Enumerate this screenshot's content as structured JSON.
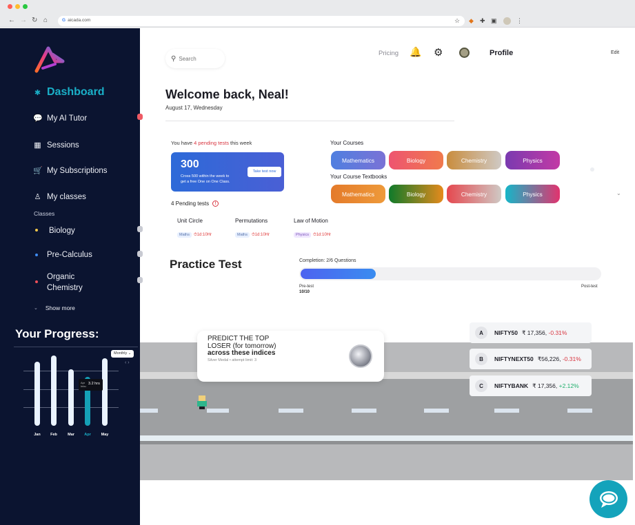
{
  "browser": {
    "url": "aicada.com"
  },
  "sidebar": {
    "dashboard": "Dashboard",
    "ai_tutor": "My AI Tutor",
    "sessions": "Sessions",
    "subscriptions": "My Subscriptions",
    "my_classes": "My classes",
    "classes_label": "Classes",
    "classes": [
      {
        "label": "Biology",
        "color": "#f3c84b"
      },
      {
        "label": "Pre-Calculus",
        "color": "#3f8cf3"
      },
      {
        "label_line1": "Organic",
        "label_line2": "Chemistry",
        "color": "#ee4f58"
      }
    ],
    "show_more": "Show more",
    "progress_title": "Your Progress:",
    "period": "Monthly",
    "chart_data": {
      "type": "bar",
      "categories": [
        "Jan",
        "Feb",
        "Mar",
        "Apr",
        "May"
      ],
      "values": [
        4.2,
        4.6,
        3.7,
        3.2,
        4.4
      ],
      "highlight": "Apr",
      "tooltip_value": "3.2 hrs",
      "tooltip_label_1": "Apr",
      "tooltip_label_2": "Inbu",
      "grid": true
    }
  },
  "header": {
    "search_placeholder": "Search",
    "pricing": "Pricing",
    "profile": "Profile",
    "edit": "Edit"
  },
  "welcome": {
    "title": "Welcome back, Neal!",
    "date": "August 17, Wednesday"
  },
  "pending": {
    "prefix": "You have ",
    "highlight": "4 pending tests",
    "suffix": " this week",
    "score": "300",
    "score_desc_1": "Cross 500 within the week to",
    "score_desc_2": "get a free One on One Class.",
    "cta": "Take test now",
    "count_label": "4 Pending tests",
    "tests": [
      {
        "title": "Unit Circle",
        "tag": "Maths",
        "time": "1d:10Hr"
      },
      {
        "title": "Permutations",
        "tag": "Maths",
        "time": "1d:10Hr"
      },
      {
        "title": "Law of Motion",
        "tag": "Physics",
        "time": "1d:10Hr"
      }
    ]
  },
  "courses": {
    "label": "Your Courses",
    "items": [
      "Mathematics",
      "Biology",
      "Chemistry",
      "Physics"
    ],
    "textbook_label": "Your Course Textbooks",
    "textbooks": [
      "Mathematics",
      "Biology",
      "Chemistry",
      "Physics"
    ]
  },
  "practice": {
    "title": "Practice Test",
    "completion_label": "Completion: ",
    "completion_value": "2/6 Questions",
    "progress_fraction": 0.25,
    "pre": "Pre-test",
    "pre_score": "10/10",
    "post": "Post-test"
  },
  "game": {
    "prompt_1": "PREDICT THE TOP",
    "prompt_2": "LOSER (for tomorrow)",
    "prompt_3": "across these indices",
    "meta": "Silver Medal • attempt limit: 3",
    "stocks": [
      {
        "letter": "A",
        "name": "NIFTY50",
        "price": "₹ 17,356,",
        "change": "-0.31%",
        "dir": "neg"
      },
      {
        "letter": "B",
        "name": "NIFTYNEXT50",
        "price": "₹56,226,",
        "change": "-0.31%",
        "dir": "neg"
      },
      {
        "letter": "C",
        "name": "NIFTYBANK",
        "price": "₹ 17,356,",
        "change": "+2.12%",
        "dir": "pos"
      }
    ]
  },
  "colors": {
    "sidebar": "#0b1430",
    "accent": "#1ab0c8",
    "pending": "#d8343f"
  }
}
